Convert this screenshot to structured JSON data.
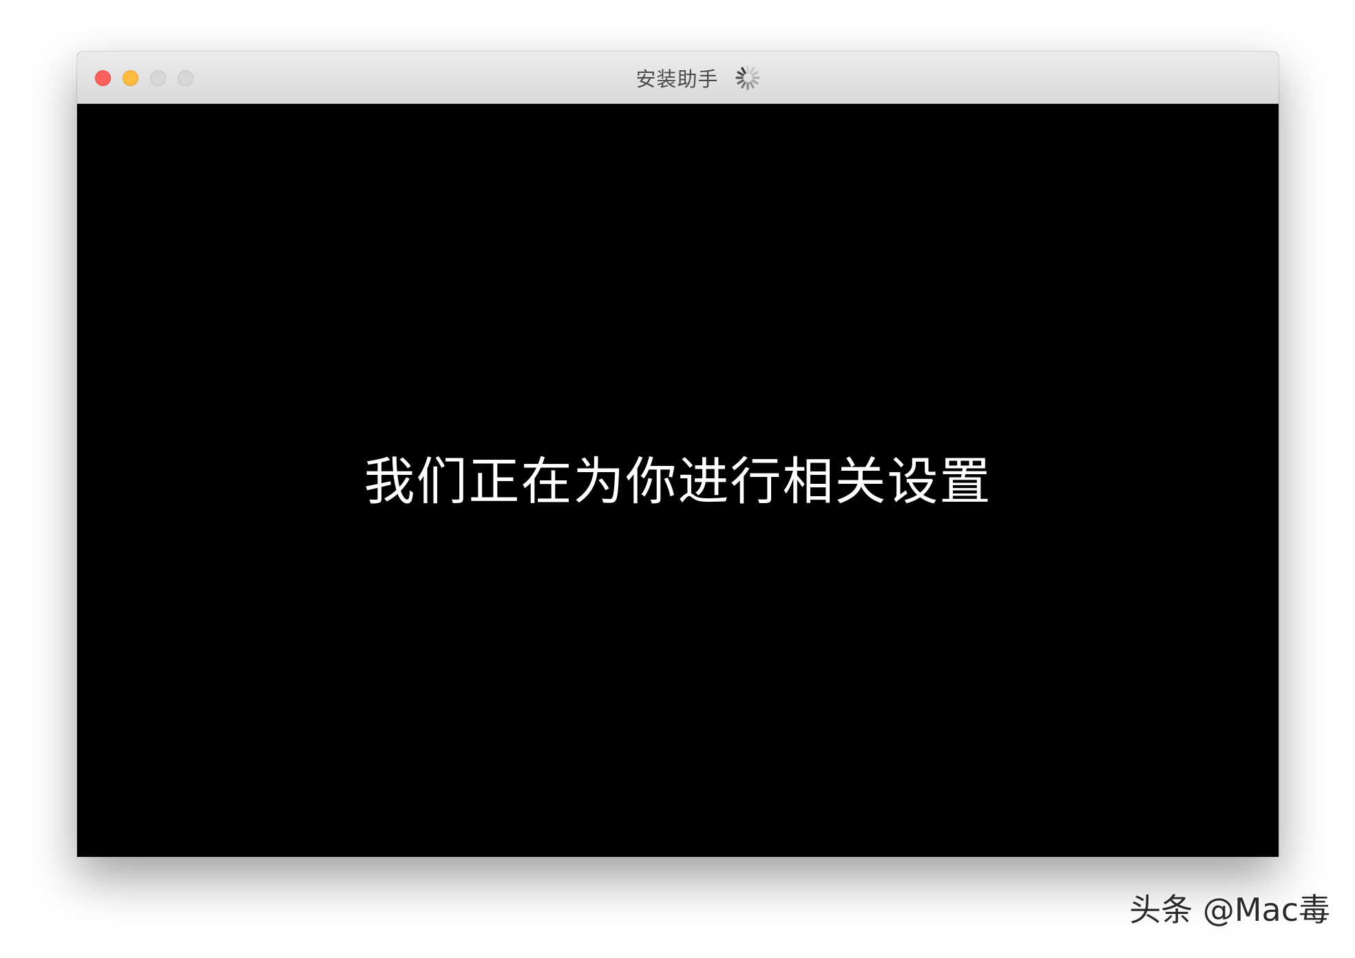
{
  "window": {
    "title": "安装助手",
    "controls": [
      {
        "name": "close",
        "color": "#fc605c"
      },
      {
        "name": "minimize",
        "color": "#fdbc40"
      },
      {
        "name": "zoom",
        "color": "#d7d7d7"
      },
      {
        "name": "extra",
        "color": "#d7d7d7"
      }
    ],
    "status_icon": "loading-spinner-icon"
  },
  "content": {
    "message": "我们正在为你进行相关设置",
    "background": "#000000"
  },
  "watermark": {
    "text": "头条 @Mac毒"
  }
}
